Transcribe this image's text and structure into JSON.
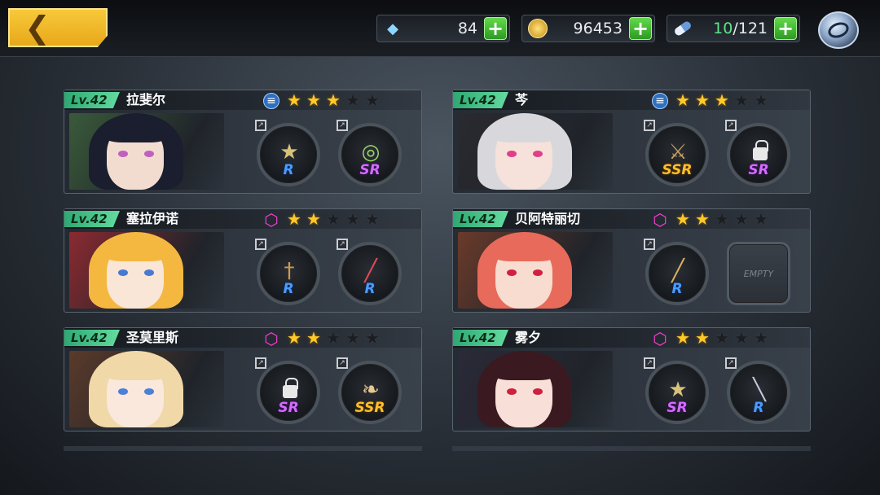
{
  "resources": {
    "gems": {
      "icon": "gem-icon",
      "value": "84"
    },
    "gold": {
      "icon": "coin-icon",
      "value": "96453"
    },
    "stamina": {
      "icon": "pill-icon",
      "current": "10",
      "max": "/121"
    }
  },
  "characters": [
    {
      "level": "Lv.42",
      "name": "拉斐尔",
      "rank": "blue",
      "stars": 3,
      "slots": [
        {
          "rarity": "R",
          "icon": "fan-weapon-icon"
        },
        {
          "rarity": "SR",
          "icon": "ring-weapon-icon"
        }
      ],
      "palette": {
        "hair": "#1a1e2e",
        "bg": "#3a5a3a",
        "eye": "#c060c0",
        "skin": "#f2dcd0"
      }
    },
    {
      "level": "Lv.42",
      "name": "芩",
      "rank": "blue",
      "stars": 3,
      "slots": [
        {
          "rarity": "SSR",
          "icon": "swords-weapon-icon"
        },
        {
          "rarity": "SR",
          "icon": "locked-weapon-icon",
          "locked": true
        }
      ],
      "palette": {
        "hair": "#d8d8dc",
        "bg": "#2a2a30",
        "eye": "#e0408a",
        "skin": "#f6e2da"
      }
    },
    {
      "level": "Lv.42",
      "name": "塞拉伊诺",
      "rank": "hex",
      "stars": 2,
      "slots": [
        {
          "rarity": "R",
          "icon": "crossbow-weapon-icon"
        },
        {
          "rarity": "R",
          "icon": "blade-weapon-icon"
        }
      ],
      "palette": {
        "hair": "#f4b840",
        "bg": "#8a2a30",
        "eye": "#4a7ad0",
        "skin": "#fae6d6"
      }
    },
    {
      "level": "Lv.42",
      "name": "贝阿特丽切",
      "rank": "hex",
      "stars": 2,
      "slots": [
        {
          "rarity": "R",
          "icon": "rapier-weapon-icon"
        },
        {
          "rarity": "",
          "icon": "empty-slot",
          "empty": true,
          "label": "EMPTY"
        }
      ],
      "palette": {
        "hair": "#e86a5a",
        "bg": "#6a3a2a",
        "eye": "#d02040",
        "skin": "#f8dcd0"
      }
    },
    {
      "level": "Lv.42",
      "name": "圣莫里斯",
      "rank": "hex",
      "stars": 2,
      "slots": [
        {
          "rarity": "SR",
          "icon": "locked-weapon-icon",
          "locked": true
        },
        {
          "rarity": "SSR",
          "icon": "bow-weapon-icon"
        }
      ],
      "palette": {
        "hair": "#f0d8a8",
        "bg": "#5a3a2a",
        "eye": "#4a80d8",
        "skin": "#fae8dc"
      }
    },
    {
      "level": "Lv.42",
      "name": "雾夕",
      "rank": "hex",
      "stars": 2,
      "slots": [
        {
          "rarity": "SR",
          "icon": "fan-weapon-icon"
        },
        {
          "rarity": "R",
          "icon": "katana-weapon-icon"
        }
      ],
      "palette": {
        "hair": "#3a1a20",
        "bg": "#2a2a38",
        "eye": "#d02040",
        "skin": "#f8e0d8"
      }
    }
  ],
  "colors": {
    "accent": "#f7c93a",
    "level_green": "#2ea872",
    "star_on": "#ffc92a"
  }
}
